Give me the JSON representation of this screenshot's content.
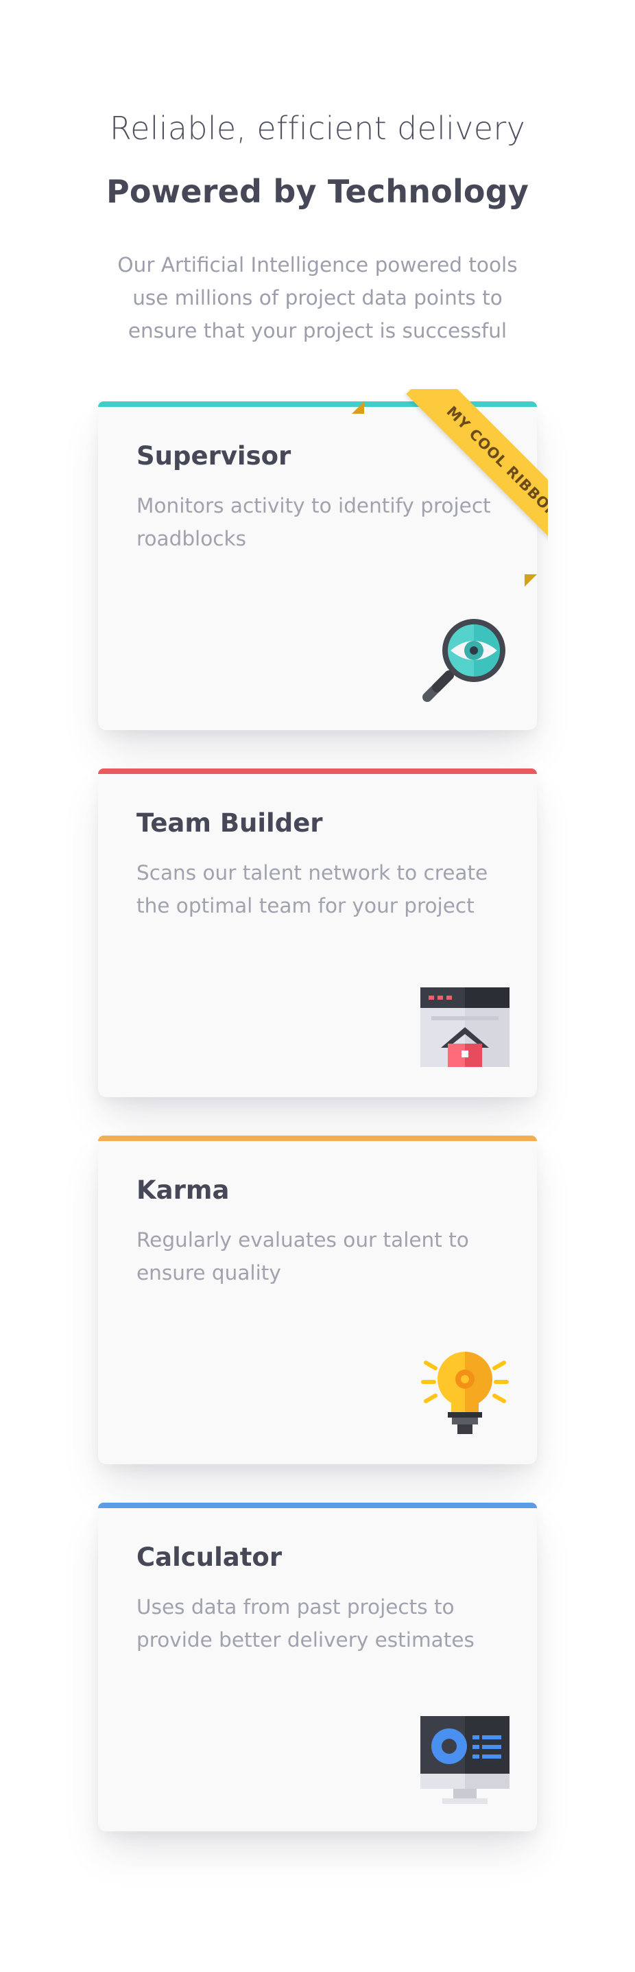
{
  "header": {
    "eyebrow": "Reliable, efficient delivery",
    "headline": "Powered by Technology",
    "intro": "Our Artificial Intelligence powered tools use millions of project data points to ensure that your project is successful"
  },
  "cards": [
    {
      "title": "Supervisor",
      "description": "Monitors activity to identify project roadblocks",
      "accent": "#3ecfc9",
      "icon": "magnifier-eye-icon",
      "ribbon": "MY COOL RIBBON"
    },
    {
      "title": "Team Builder",
      "description": "Scans our talent network to create the optimal team for your project",
      "accent": "#e85a5f",
      "icon": "browser-house-icon"
    },
    {
      "title": "Karma",
      "description": "Regularly evaluates our talent to ensure quality",
      "accent": "#f5ad4f",
      "icon": "lightbulb-gear-icon"
    },
    {
      "title": "Calculator",
      "description": "Uses data from past projects to provide better delivery estimates",
      "accent": "#5b9ce8",
      "icon": "monitor-dashboard-icon"
    }
  ],
  "colors": {
    "ribbon": "#fdca3e",
    "ribbon_text": "#6b4b17",
    "card_bg": "#f9f9f9",
    "heading": "#464858",
    "muted": "#a1a2ae"
  }
}
